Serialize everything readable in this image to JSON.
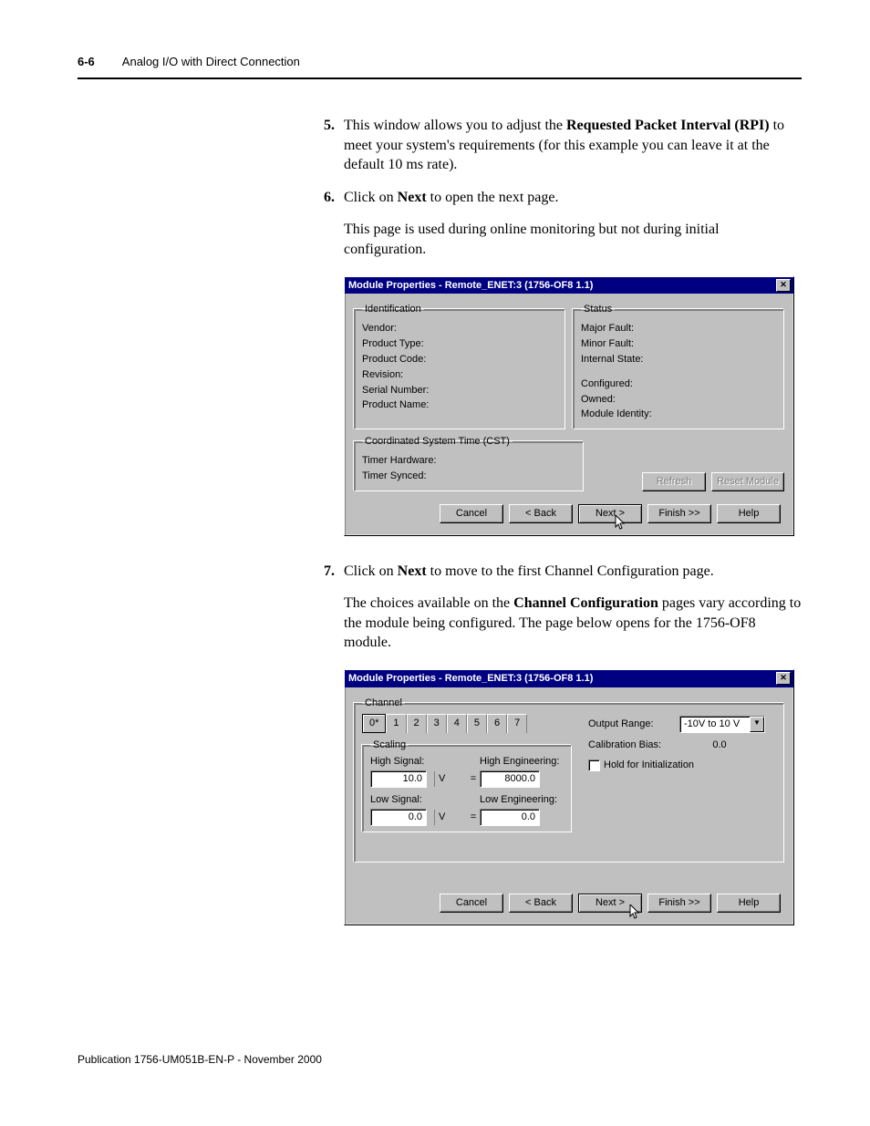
{
  "header": {
    "page_number": "6-6",
    "section_title": "Analog I/O with Direct Connection"
  },
  "steps": {
    "s5": {
      "num": "5.",
      "text_a": "This window allows you to adjust the ",
      "bold_a": "Requested Packet Interval (RPI)",
      "text_b": " to meet your system's requirements (for this example you can leave it at the default 10 ms rate)."
    },
    "s6": {
      "num": "6.",
      "text_a": "Click on ",
      "bold_a": "Next",
      "text_b": " to open the next page."
    },
    "p6": "This page is used during online monitoring but not during initial configuration.",
    "s7": {
      "num": "7.",
      "text_a": "Click on ",
      "bold_a": "Next",
      "text_b": " to move to the first Channel Configuration page."
    },
    "p7_a": "The choices available on the ",
    "p7_bold": "Channel Configuration",
    "p7_b": " pages vary according to the module being configured. The page below opens for the 1756-OF8 module."
  },
  "dialog1": {
    "title": "Module Properties - Remote_ENET:3 (1756-OF8 1.1)",
    "close_glyph": "✕",
    "ident_legend": "Identification",
    "ident": {
      "vendor": "Vendor:",
      "ptype": "Product Type:",
      "pcode": "Product Code:",
      "rev": "Revision:",
      "serial": "Serial Number:",
      "pname": "Product Name:"
    },
    "status_legend": "Status",
    "status": {
      "major": "Major Fault:",
      "minor": "Minor Fault:",
      "istate": "Internal State:",
      "config": "Configured:",
      "owned": "Owned:",
      "mid": "Module Identity:"
    },
    "cst_legend": "Coordinated System Time (CST)",
    "cst": {
      "thw": "Timer Hardware:",
      "tsync": "Timer Synced:"
    },
    "buttons": {
      "refresh": "Refresh",
      "reset": "Reset Module",
      "cancel": "Cancel",
      "back": "< Back",
      "next": "Next >",
      "finish": "Finish >>",
      "help": "Help"
    }
  },
  "dialog2": {
    "title": "Module Properties - Remote_ENET:3 (1756-OF8 1.1)",
    "close_glyph": "✕",
    "channel_legend": "Channel",
    "tabs": [
      "0*",
      "1",
      "2",
      "3",
      "4",
      "5",
      "6",
      "7"
    ],
    "scaling_legend": "Scaling",
    "scaling": {
      "hs_lbl": "High Signal:",
      "he_lbl": "High Engineering:",
      "ls_lbl": "Low Signal:",
      "le_lbl": "Low Engineering:",
      "hs_val": "10.0",
      "he_val": "8000.0",
      "ls_val": "0.0",
      "le_val": "0.0",
      "unit": "V",
      "eq": "="
    },
    "right": {
      "out_range_lbl": "Output Range:",
      "out_range_val": "-10V to 10 V",
      "cal_bias_lbl": "Calibration Bias:",
      "cal_bias_val": "0.0",
      "hold_init": "Hold for Initialization"
    },
    "buttons": {
      "cancel": "Cancel",
      "back": "< Back",
      "next": "Next >",
      "finish": "Finish >>",
      "help": "Help"
    }
  },
  "footer": "Publication 1756-UM051B-EN-P - November 2000"
}
